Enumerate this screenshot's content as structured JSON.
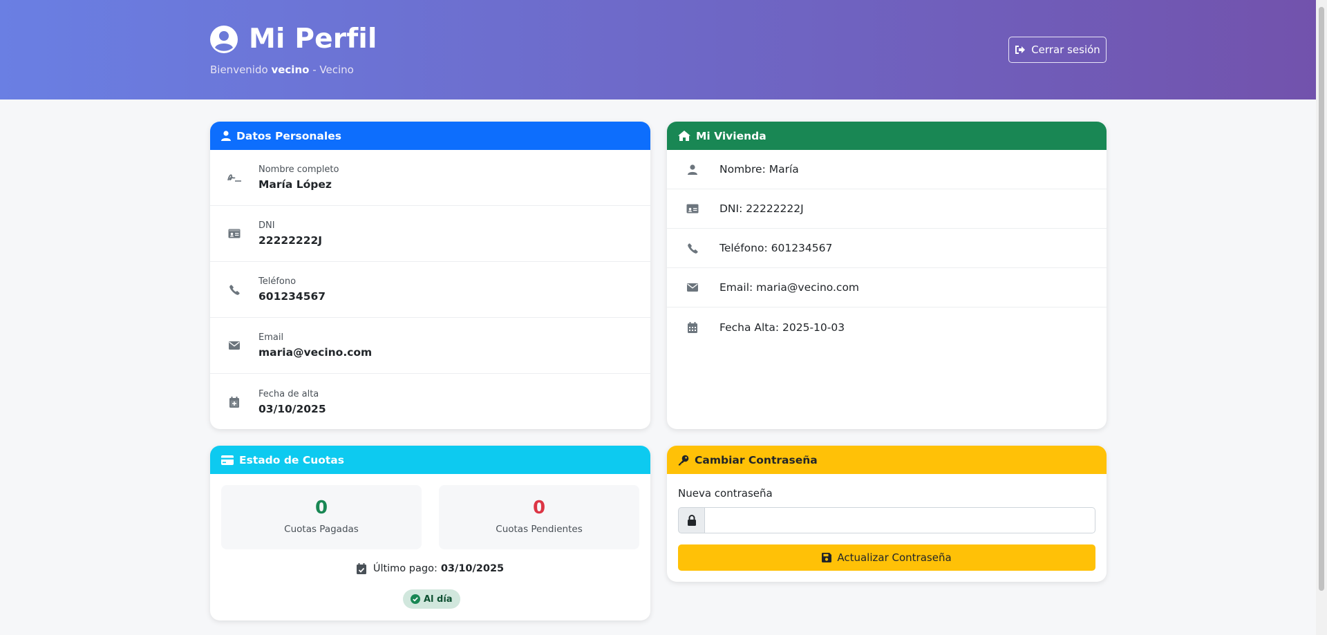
{
  "header": {
    "title": "Mi Perfil",
    "welcome_prefix": "Bienvenido",
    "username": "vecino",
    "role_suffix": "- Vecino",
    "logout_label": "Cerrar sesión"
  },
  "personal": {
    "title": "Datos Personales",
    "rows": [
      {
        "icon": "signature-icon",
        "label": "Nombre completo",
        "value": "María López"
      },
      {
        "icon": "id-card-icon",
        "label": "DNI",
        "value": "22222222J"
      },
      {
        "icon": "phone-icon",
        "label": "Teléfono",
        "value": "601234567"
      },
      {
        "icon": "envelope-icon",
        "label": "Email",
        "value": "maria@vecino.com"
      },
      {
        "icon": "calendar-plus-icon",
        "label": "Fecha de alta",
        "value": "03/10/2025"
      }
    ]
  },
  "housing": {
    "title": "Mi Vivienda",
    "rows": [
      {
        "icon": "user-icon",
        "text": "Nombre: María"
      },
      {
        "icon": "id-card-icon",
        "text": "DNI: 22222222J"
      },
      {
        "icon": "phone-icon",
        "text": "Teléfono: 601234567"
      },
      {
        "icon": "envelope-icon",
        "text": "Email: maria@vecino.com"
      },
      {
        "icon": "calendar-icon",
        "text": "Fecha Alta: 2025-10-03"
      }
    ]
  },
  "fees": {
    "title": "Estado de Cuotas",
    "paid_count": "0",
    "paid_label": "Cuotas Pagadas",
    "pending_count": "0",
    "pending_label": "Cuotas Pendientes",
    "last_payment_label": "Último pago:",
    "last_payment_date": "03/10/2025",
    "status_badge": "Al día"
  },
  "password": {
    "title": "Cambiar Contraseña",
    "field_label": "Nueva contraseña",
    "field_value": "",
    "button_label": "Actualizar Contraseña"
  },
  "colors": {
    "primary": "#0d6efd",
    "success": "#198754",
    "info": "#0dcaf0",
    "warning": "#ffc107",
    "danger": "#dc3545"
  }
}
